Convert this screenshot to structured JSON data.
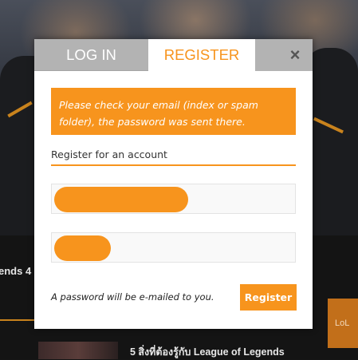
{
  "background": {
    "left_text": "ends 4",
    "article_title": "5 สิ่งที่ต้องรู้กับ League of Legends",
    "side_badge": "LoL"
  },
  "modal": {
    "tabs": {
      "login": "LOG IN",
      "register": "REGISTER",
      "close": "×"
    },
    "notice": "Please check your email (index or spam folder), the password was sent there.",
    "form_heading": "Register for an account",
    "username_value": "",
    "email_value": "",
    "password_hint": "A password will be e-mailed to you.",
    "submit_label": "Register"
  },
  "colors": {
    "accent": "#f7941d",
    "tab_inactive": "#b3b3b3"
  }
}
